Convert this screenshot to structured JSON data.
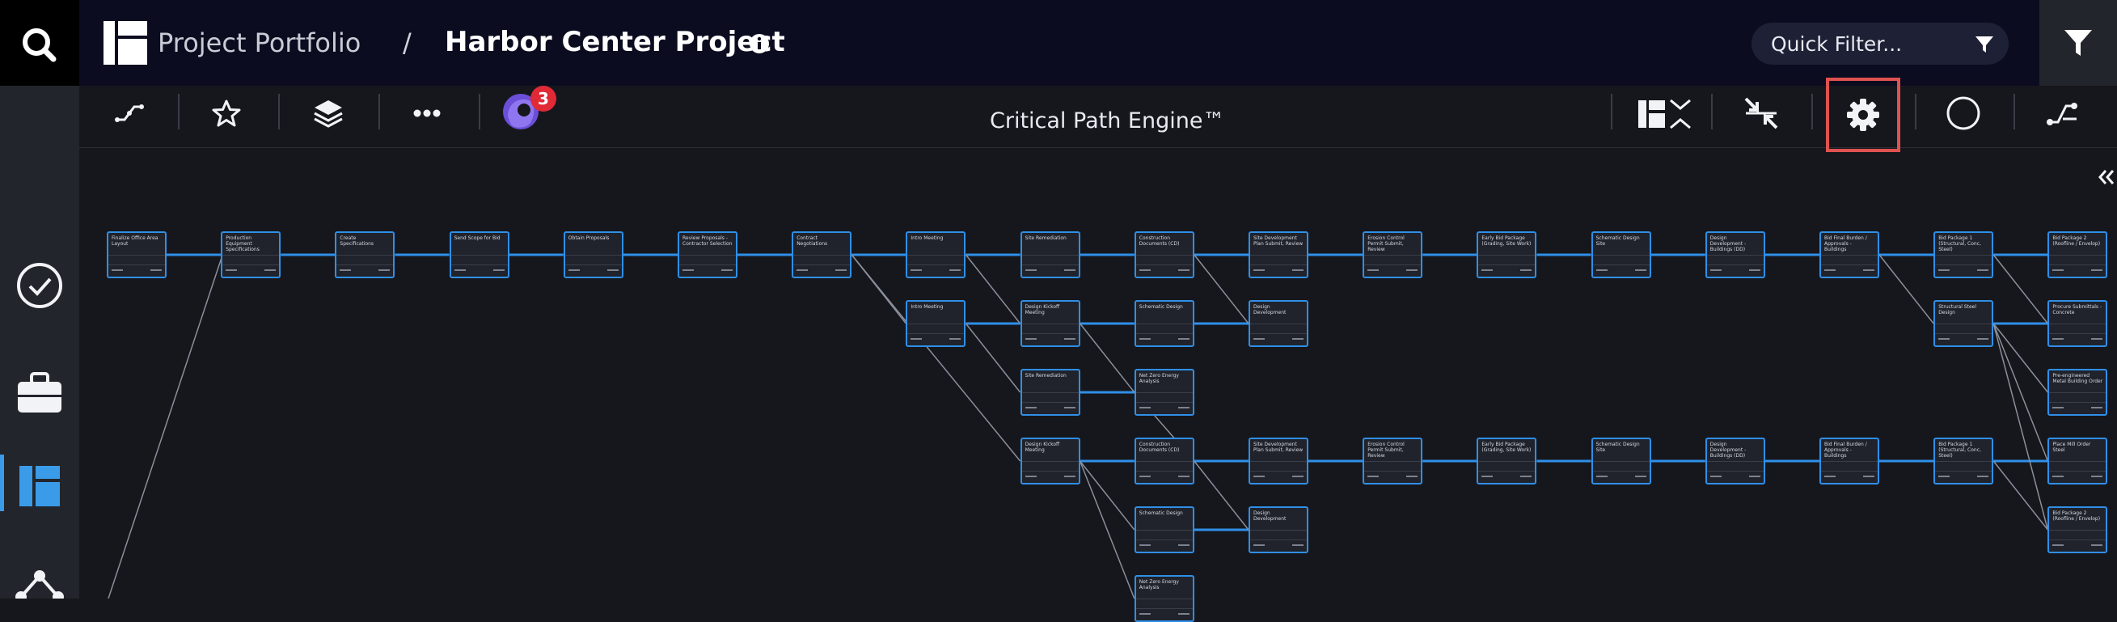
{
  "header": {
    "breadcrumb_portfolio": "Project Portfolio",
    "breadcrumb_separator": "/",
    "project_title": "Harbor Center Project",
    "quick_filter_placeholder": "Quick Filter..."
  },
  "toolbar": {
    "engine_label": "Critical Path Engine™",
    "notification_count": "3"
  },
  "colors": {
    "accent": "#2f8fe8",
    "highlight": "#e0524f",
    "header_bg": "#0b0c1f",
    "badge": "#e02a36"
  },
  "icons": {
    "rail": [
      "search-icon",
      "check-circle-icon",
      "briefcase-icon",
      "layout-icon",
      "network-icon"
    ],
    "toolbar_left": [
      "path-icon",
      "star-icon",
      "layers-icon",
      "more-icon",
      "avatar-icon"
    ],
    "toolbar_right": [
      "columns-collapse-icon",
      "compress-icon",
      "gear-icon",
      "circle-icon",
      "flow-icon"
    ]
  },
  "nodes": [
    {
      "id": "n1",
      "label": "Finalize Office Area Layout",
      "col": 0,
      "row": 0
    },
    {
      "id": "n2",
      "label": "Production Equipment Specifications",
      "col": 1,
      "row": 0
    },
    {
      "id": "n3",
      "label": "Create Specifications",
      "col": 2,
      "row": 0
    },
    {
      "id": "n4",
      "label": "Send Scope for Bid",
      "col": 3,
      "row": 0
    },
    {
      "id": "n5",
      "label": "Obtain Proposals",
      "col": 4,
      "row": 0
    },
    {
      "id": "n6",
      "label": "Review Proposals - Contractor Selection",
      "col": 5,
      "row": 0
    },
    {
      "id": "n7",
      "label": "Contract Negotiations",
      "col": 6,
      "row": 0
    },
    {
      "id": "n8",
      "label": "Intro Meeting",
      "col": 7,
      "row": 0
    },
    {
      "id": "n9",
      "label": "Site Remediation",
      "col": 8,
      "row": 0
    },
    {
      "id": "n10",
      "label": "Construction Documents (CD)",
      "col": 9,
      "row": 0
    },
    {
      "id": "n11",
      "label": "Site Development Plan Submit, Review",
      "col": 10,
      "row": 0
    },
    {
      "id": "n12",
      "label": "Erosion Control Permit Submit, Review",
      "col": 11,
      "row": 0
    },
    {
      "id": "n13",
      "label": "Early Bid Package (Grading, Site Work)",
      "col": 12,
      "row": 0
    },
    {
      "id": "n14",
      "label": "Schematic Design Site",
      "col": 13,
      "row": 0
    },
    {
      "id": "n15",
      "label": "Design Development - Buildings (DD)",
      "col": 14,
      "row": 0
    },
    {
      "id": "n16",
      "label": "Bid Final Burden / Approvals - Buildings",
      "col": 15,
      "row": 0
    },
    {
      "id": "n17",
      "label": "Bid Package 1 (Structural, Conc, Steel)",
      "col": 16,
      "row": 0
    },
    {
      "id": "n18",
      "label": "Bid Package 2 (Roofline / Envelop)",
      "col": 17,
      "row": 0
    },
    {
      "id": "n19",
      "label": "Intro Meeting",
      "col": 7,
      "row": 1
    },
    {
      "id": "n20",
      "label": "Design Kickoff Meeting",
      "col": 8,
      "row": 1
    },
    {
      "id": "n21",
      "label": "Schematic Design",
      "col": 9,
      "row": 1
    },
    {
      "id": "n22",
      "label": "Design Development",
      "col": 10,
      "row": 1
    },
    {
      "id": "n23",
      "label": "Structural Steel Design",
      "col": 16,
      "row": 1
    },
    {
      "id": "n24",
      "label": "Procure Submittals - Concrete",
      "col": 17,
      "row": 1
    },
    {
      "id": "n25",
      "label": "Site Remediation",
      "col": 8,
      "row": 2
    },
    {
      "id": "n26",
      "label": "Net Zero Energy Analysis",
      "col": 9,
      "row": 2
    },
    {
      "id": "n27",
      "label": "Pre-engineered Metal Building Order",
      "col": 17,
      "row": 2
    },
    {
      "id": "n28",
      "label": "Design Kickoff Meeting",
      "col": 8,
      "row": 3
    },
    {
      "id": "n29",
      "label": "Construction Documents (CD)",
      "col": 9,
      "row": 3
    },
    {
      "id": "n30",
      "label": "Site Development Plan Submit, Review",
      "col": 10,
      "row": 3
    },
    {
      "id": "n31",
      "label": "Erosion Control Permit Submit, Review",
      "col": 11,
      "row": 3
    },
    {
      "id": "n32",
      "label": "Early Bid Package (Grading, Site Work)",
      "col": 12,
      "row": 3
    },
    {
      "id": "n33",
      "label": "Schematic Design Site",
      "col": 13,
      "row": 3
    },
    {
      "id": "n34",
      "label": "Design Development - Buildings (DD)",
      "col": 14,
      "row": 3
    },
    {
      "id": "n35",
      "label": "Bid Final Burden / Approvals - Buildings",
      "col": 15,
      "row": 3
    },
    {
      "id": "n36",
      "label": "Bid Package 1 (Structural, Conc, Steel)",
      "col": 16,
      "row": 3
    },
    {
      "id": "n37",
      "label": "Place Mill Order Steel",
      "col": 17,
      "row": 3
    },
    {
      "id": "n38",
      "label": "Schematic Design",
      "col": 9,
      "row": 4
    },
    {
      "id": "n39",
      "label": "Design Development",
      "col": 10,
      "row": 4
    },
    {
      "id": "n40",
      "label": "Bid Package 2 (Roofline / Envelop)",
      "col": 17,
      "row": 4
    },
    {
      "id": "n41",
      "label": "Net Zero Energy Analysis",
      "col": 9,
      "row": 5
    }
  ],
  "edges": [
    [
      "n1",
      "n2"
    ],
    [
      "n2",
      "n3"
    ],
    [
      "n3",
      "n4"
    ],
    [
      "n4",
      "n5"
    ],
    [
      "n5",
      "n6"
    ],
    [
      "n6",
      "n7"
    ],
    [
      "n7",
      "n8"
    ],
    [
      "n8",
      "n9"
    ],
    [
      "n9",
      "n10"
    ],
    [
      "n10",
      "n11"
    ],
    [
      "n11",
      "n12"
    ],
    [
      "n12",
      "n13"
    ],
    [
      "n13",
      "n14"
    ],
    [
      "n14",
      "n15"
    ],
    [
      "n15",
      "n16"
    ],
    [
      "n16",
      "n17"
    ],
    [
      "n17",
      "n18"
    ],
    [
      "n7",
      "n19"
    ],
    [
      "n19",
      "n20"
    ],
    [
      "n20",
      "n21"
    ],
    [
      "n21",
      "n22"
    ],
    [
      "n8",
      "n20"
    ],
    [
      "n10",
      "n22"
    ],
    [
      "n16",
      "n23"
    ],
    [
      "n23",
      "n24"
    ],
    [
      "n17",
      "n24"
    ],
    [
      "n19",
      "n25"
    ],
    [
      "n25",
      "n26"
    ],
    [
      "n20",
      "n26"
    ],
    [
      "n23",
      "n27"
    ],
    [
      "n7",
      "n28"
    ],
    [
      "n28",
      "n29"
    ],
    [
      "n29",
      "n30"
    ],
    [
      "n30",
      "n31"
    ],
    [
      "n31",
      "n32"
    ],
    [
      "n32",
      "n33"
    ],
    [
      "n33",
      "n34"
    ],
    [
      "n34",
      "n35"
    ],
    [
      "n35",
      "n36"
    ],
    [
      "n36",
      "n37"
    ],
    [
      "n23",
      "n37"
    ],
    [
      "n28",
      "n38"
    ],
    [
      "n38",
      "n39"
    ],
    [
      "n29",
      "n39"
    ],
    [
      "n36",
      "n40"
    ],
    [
      "n23",
      "n40"
    ],
    [
      "n28",
      "n41"
    ],
    [
      "n29",
      "n26"
    ]
  ]
}
